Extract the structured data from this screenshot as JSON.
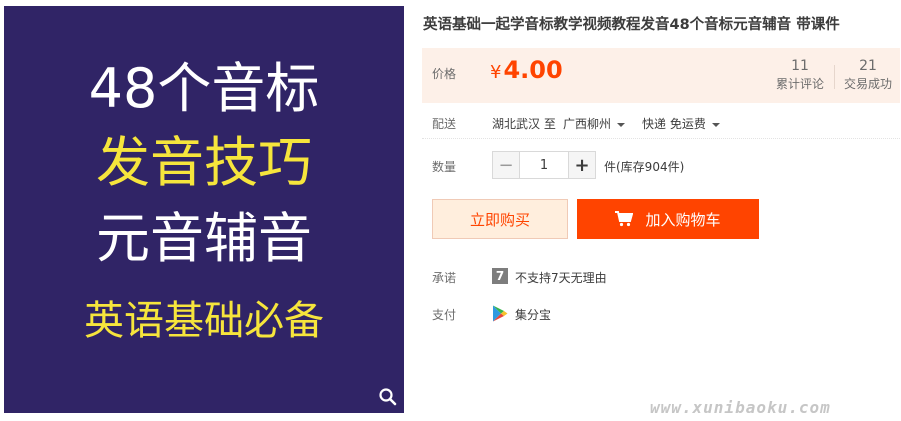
{
  "product_image": {
    "line1": "48个音标",
    "line2": "发音技巧",
    "line3": "元音辅音",
    "line4": "英语基础必备",
    "colors": {
      "background": "#302466",
      "white_text": "#ffffff",
      "yellow_text": "#f6e53c"
    },
    "zoom_icon": "magnifier-icon"
  },
  "title": "英语基础一起学音标教学视频教程发音48个音标元音辅音 带课件",
  "price": {
    "label": "价格",
    "currency": "¥",
    "value": "4.00",
    "color": "#ff4400"
  },
  "stats": {
    "reviews": {
      "count": "11",
      "label": "累计评论"
    },
    "sales": {
      "count": "21",
      "label": "交易成功"
    }
  },
  "delivery": {
    "label": "配送",
    "from": "湖北武汉 至",
    "to": "广西柳州",
    "method": "快递 免运费"
  },
  "quantity": {
    "label": "数量",
    "minus": "−",
    "value": "1",
    "plus": "+",
    "stock": "件(库存904件)"
  },
  "buttons": {
    "buy_now": "立即购买",
    "add_to_cart": "加入购物车",
    "cart_icon": "shopping-cart-icon"
  },
  "promise": {
    "label": "承诺",
    "icon_glyph": "7",
    "text": "不支持7天无理由"
  },
  "payment": {
    "label": "支付",
    "text": "集分宝",
    "icon": "play-store-icon"
  },
  "watermark": "www.xunibaoku.com"
}
